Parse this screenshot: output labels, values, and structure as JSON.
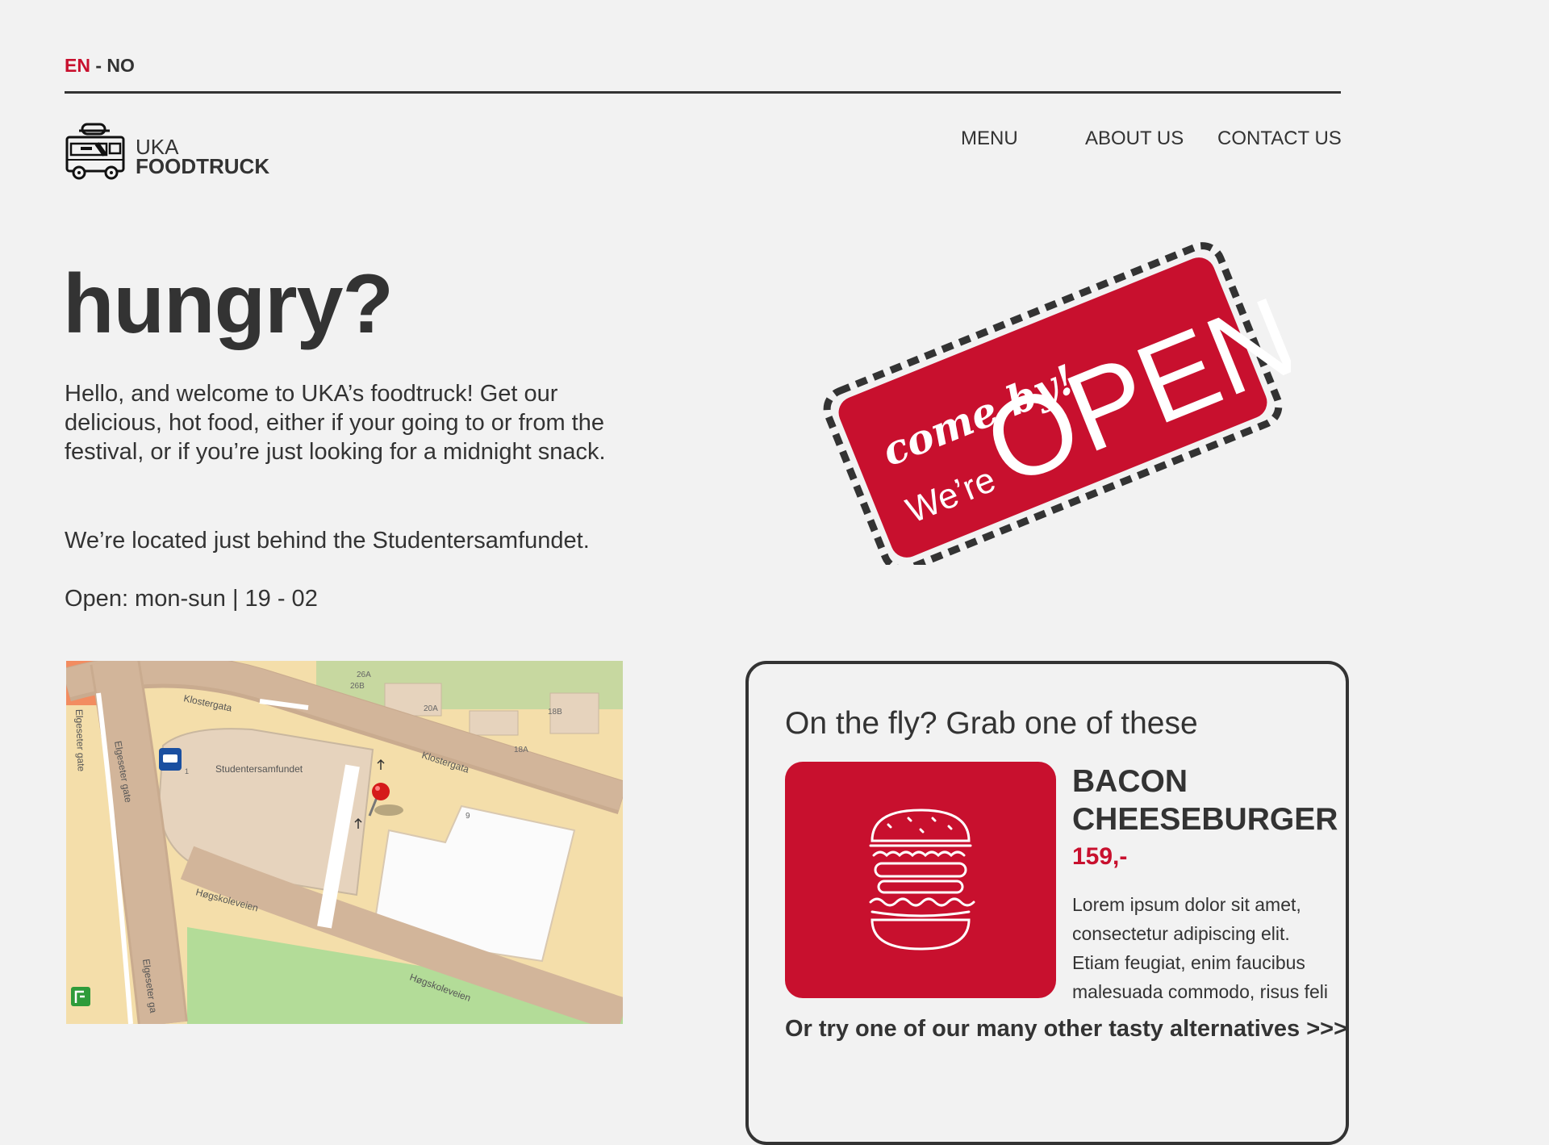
{
  "language": {
    "en": "EN",
    "separator": "-",
    "no": "NO"
  },
  "brand": {
    "line1": "UKA",
    "line2": "FOODTRUCK",
    "icon": "foodtruck-icon"
  },
  "nav": {
    "items": [
      "MENU",
      "ABOUT US",
      "CONTACT US"
    ]
  },
  "hero": {
    "title": "hungry?",
    "intro": "Hello, and welcome to UKA’s foodtruck! Get our delicious, hot food, either if your going to or from the festival, or if you’re just looking for a midnight snack.",
    "location": "We’re located just behind the Studentersamfundet.",
    "hours": "Open: mon-sun | 19 - 02"
  },
  "sign": {
    "come_by": "come by!",
    "were": "We’re",
    "open": "OPEN"
  },
  "map": {
    "labels": {
      "klostergata_1": "Klostergata",
      "klostergata_2": "Klostergata",
      "studentersamfundet": "Studentersamfundet",
      "eigeseter_1": "Elgeseter gate",
      "eigeseter_2": "Elgeseter gate",
      "eigeseter_3": "Elgeseter ga",
      "hogskoleveien_1": "Høgskoleveien",
      "hogskoleveien_2": "Høgskoleveien",
      "n26a": "26A",
      "n26b": "26B",
      "n20a": "20A",
      "n18a": "18A",
      "n18b": "18B",
      "n9": "9",
      "n1": "1"
    }
  },
  "featured": {
    "heading": "On the fly? Grab one of these",
    "item_name": "BACON CHEESEBURGER",
    "price": "159,-",
    "description": "Lorem ipsum dolor sit amet, consectetur adipiscing elit. Etiam feugiat, enim faucibus malesuada commodo, risus feli",
    "more": "Or try one of our many other tasty alternatives >>>"
  },
  "colors": {
    "accent": "#c8102e",
    "text": "#333333",
    "background": "#f2f2f2"
  }
}
